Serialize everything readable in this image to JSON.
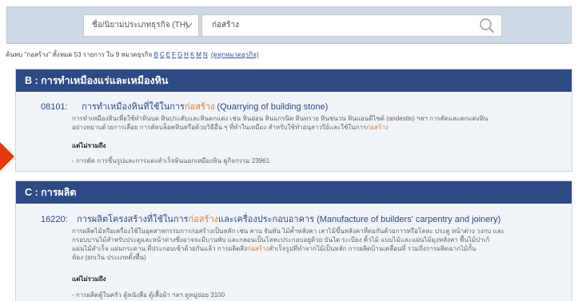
{
  "search": {
    "dropdown_label": "ชื่อ/นิยามประเภทธุรกิจ (TH)",
    "query": "ก่อสร้าง"
  },
  "summary": {
    "text": "ค้นพบ \"ก่อสร้าง\" ทั้งหมด 53 รายการ ใน 9 หมวดธุรกิจ",
    "letters": [
      "B",
      "C",
      "E",
      "F",
      "G",
      "H",
      "K",
      "M",
      "N"
    ],
    "view_all": "(ดูทุกหมวดธุรกิจ)"
  },
  "sections": [
    {
      "header": "B : การทำเหมืองแร่และเหมืองหิน",
      "code": "08101:",
      "title_pre": "การทำเหมืองหินที่ใช้ในการ",
      "title_hl": "ก่อสร้าง",
      "title_post": " (Quarrying of building stone)",
      "desc_line1": "การทำเหมืองหินเพื่อใช้ทำหินบด หินประดับและหินตกแต่ง เช่น หินอ่อน หินแกรนิต หินทราย หินชนวน หินแอนดีไซต์ (andesite) ฯลฯ การตัดและตกแต่งหิน",
      "desc_line2_pre": "อย่างหยาบด้วยการเลื่อย การตัดบล็อคหินหรือด้วยวิธีอื่น ๆ ที่ทำในเหมือง สำหรับใช้ทำอนุสาวรีย์และใช้ในการ",
      "desc_line2_hl": "ก่อสร้าง",
      "ex_label": "แต่ไม่รวมถึง",
      "ex_item": "- การตัด การขึ้นรูปและการแต่งสำเร็จหินนอกเหมืองหิน ดูกิจกรรม 23961"
    },
    {
      "header": "C : การผลิต",
      "code": "16220:",
      "title_pre": "การผลิตโครงสร้างที่ใช้ในการ",
      "title_hl": "ก่อสร้าง",
      "title_post": "และเครื่องประกอบอาคาร (Manufacture of builders' carpentry and joinery)",
      "desc_line1": "การผลิตไม้หรือเครื่องใช้ในอุตสาหกรรมการก่อสร้างเป็นหลัก เช่น คาน จันทัน ไม้ค้ำหลังคา เสาไม้ขึ้นหลังคาที่ต่อกันด้วยกาวหรือโลหะ ประตู หน้าต่าง วงกบ และ",
      "desc_line2": "กรอบบานไม้สำหรับประตูและหน้าต่างซึ่งอาจจะมีบานพับ และกลอนเป็นโลหะประกอบอยู่ด้วย บันได ระเบียง คิ้วไม้ แบบไม้และแผ่นไม้มุงหลังคา พื้นไม้ปาเก้",
      "desc_line3_pre": "แผ่นไม้สำเร็จ แผ่นกระดาน ที่ประกอบเข้าด้วยกันแล้ว การผลิตสิ่ง",
      "desc_line3_hl": "ก่อสร้าง",
      "desc_line3_post": "สำเร็จรูปที่ทำจากไม้เป็นหลัก การผลิตบ้านเคลื่อนที่ รวมถึงการผลิตฉากไม้กั้น",
      "desc_line4": "ห้อง (ยกเว้น ประเภทตั้งพื้น)",
      "ex_label": "แต่ไม่รวมถึง",
      "ex_item": "- การผลิตตู้ในครัว ตู้หนังสือ ตู้เสื้อผ้า ฯลฯ ดูหมู่ย่อย 3100"
    }
  ],
  "colors": {
    "header_bg": "#2c4a86",
    "highlight": "#e07a2e",
    "arrow": "#e8380d"
  }
}
